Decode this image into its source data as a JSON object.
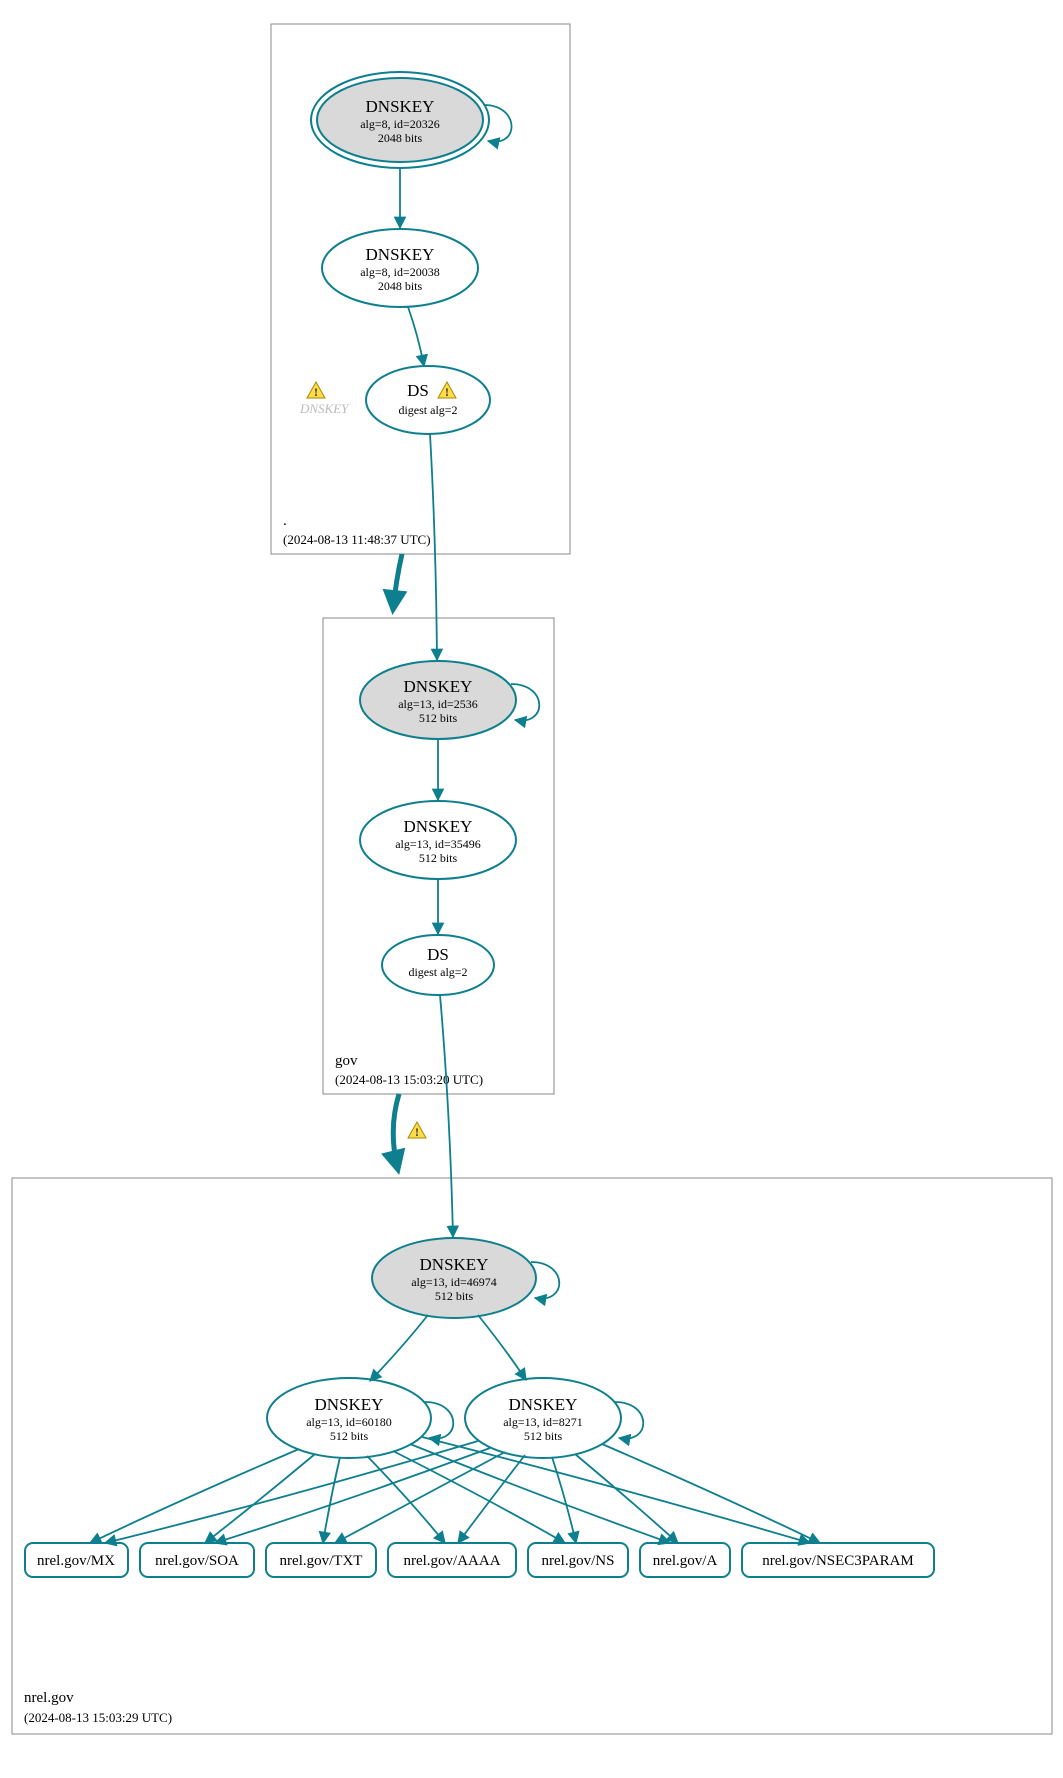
{
  "colors": {
    "stroke": "#0d7f8e",
    "sep_fill": "#d9d9d9"
  },
  "zones": {
    "root": {
      "label": ".",
      "timestamp": "(2024-08-13 11:48:37 UTC)"
    },
    "gov": {
      "label": "gov",
      "timestamp": "(2024-08-13 15:03:20 UTC)"
    },
    "nrel": {
      "label": "nrel.gov",
      "timestamp": "(2024-08-13 15:03:29 UTC)"
    }
  },
  "nodes": {
    "root_ksk": {
      "title": "DNSKEY",
      "sub1": "alg=8, id=20326",
      "sub2": "2048 bits"
    },
    "root_zsk": {
      "title": "DNSKEY",
      "sub1": "alg=8, id=20038",
      "sub2": "2048 bits"
    },
    "root_ds": {
      "title": "DS",
      "sub1": "digest alg=2"
    },
    "gov_ksk": {
      "title": "DNSKEY",
      "sub1": "alg=13, id=2536",
      "sub2": "512 bits"
    },
    "gov_zsk": {
      "title": "DNSKEY",
      "sub1": "alg=13, id=35496",
      "sub2": "512 bits"
    },
    "gov_ds": {
      "title": "DS",
      "sub1": "digest alg=2"
    },
    "nrel_ksk": {
      "title": "DNSKEY",
      "sub1": "alg=13, id=46974",
      "sub2": "512 bits"
    },
    "nrel_zsk1": {
      "title": "DNSKEY",
      "sub1": "alg=13, id=60180",
      "sub2": "512 bits"
    },
    "nrel_zsk2": {
      "title": "DNSKEY",
      "sub1": "alg=13, id=8271",
      "sub2": "512 bits"
    }
  },
  "fadedKey": "DNSKEY",
  "rrsets": [
    "nrel.gov/MX",
    "nrel.gov/SOA",
    "nrel.gov/TXT",
    "nrel.gov/AAAA",
    "nrel.gov/NS",
    "nrel.gov/A",
    "nrel.gov/NSEC3PARAM"
  ]
}
